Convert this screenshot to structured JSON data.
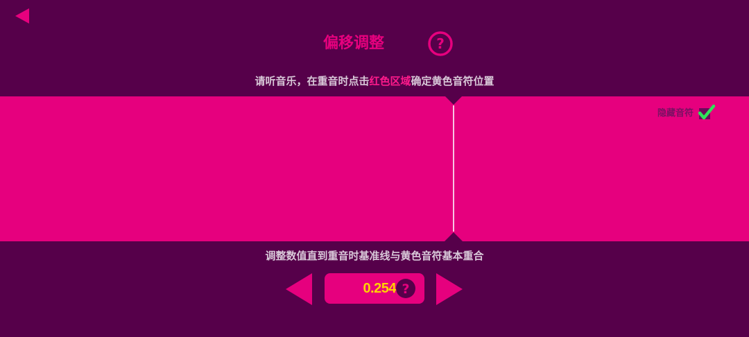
{
  "header": {
    "title": "偏移调整",
    "back_icon": "back-triangle-icon",
    "help_icon": "question-circle-icon"
  },
  "instruction": {
    "prefix": "请听音乐，在重音时点击",
    "highlight": "红色区域",
    "suffix": "确定黄色音符位置"
  },
  "track": {
    "hide_notes_label": "隐藏音符",
    "hide_notes_checked": true
  },
  "offset": {
    "hint": "调整数值直到重音时基准线与黄色音符基本重合",
    "value": "0.254",
    "decrease_icon": "left-triangle-icon",
    "increase_icon": "right-triangle-icon",
    "help_icon": "question-circle-icon"
  },
  "colors": {
    "background": "#56004a",
    "accent": "#e6007e",
    "value_text": "#ffd200",
    "check": "#2ee35a",
    "text_light": "#d8c8d8"
  }
}
